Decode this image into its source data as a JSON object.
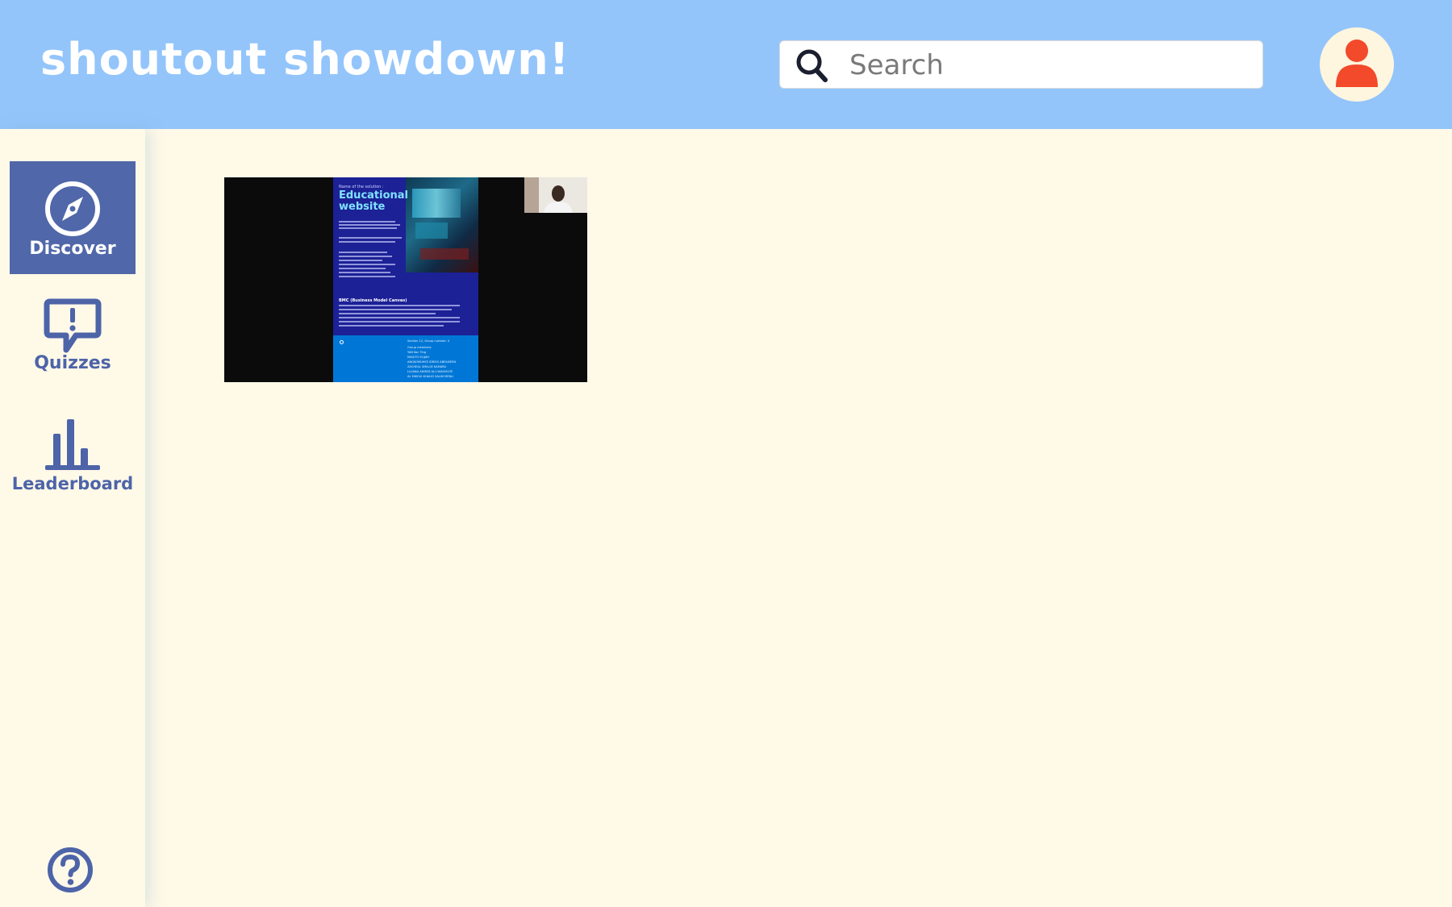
{
  "header": {
    "title": "shoutout showdown!",
    "search": {
      "placeholder": "Search",
      "value": ""
    },
    "avatar_icon": "user-icon"
  },
  "sidebar": {
    "items": [
      {
        "label": "Discover",
        "icon": "compass-icon",
        "active": true
      },
      {
        "label": "Quizzes",
        "icon": "speech-bubble-exclamation-icon",
        "active": false
      },
      {
        "label": "Leaderboard",
        "icon": "bar-chart-icon",
        "active": false
      }
    ],
    "help_icon": "help-question-icon"
  },
  "content": {
    "video": {
      "slide_kicker": "Name of the solution :",
      "slide_title": "Educational website",
      "slide_section_bmc": "BMC (Business Model Canvas)",
      "footer_lines": [
        "Section 12, Group number: 4",
        "Group members:",
        "YAB Koc Ting",
        "MAGITO ELIJAH",
        "ANGKOMUHEE IDRISS ABDUKEEN",
        "ZACHEAL SMILLIE KAMARA",
        "LLUANA AHMED ALI HAKHOUTE",
        "AL MIKOUI KHALID SALIM MENLI"
      ]
    }
  },
  "colors": {
    "header_bg": "#93c5fb",
    "page_bg": "#fff9e8",
    "accent": "#5067a9",
    "avatar_red": "#f24a2b"
  }
}
